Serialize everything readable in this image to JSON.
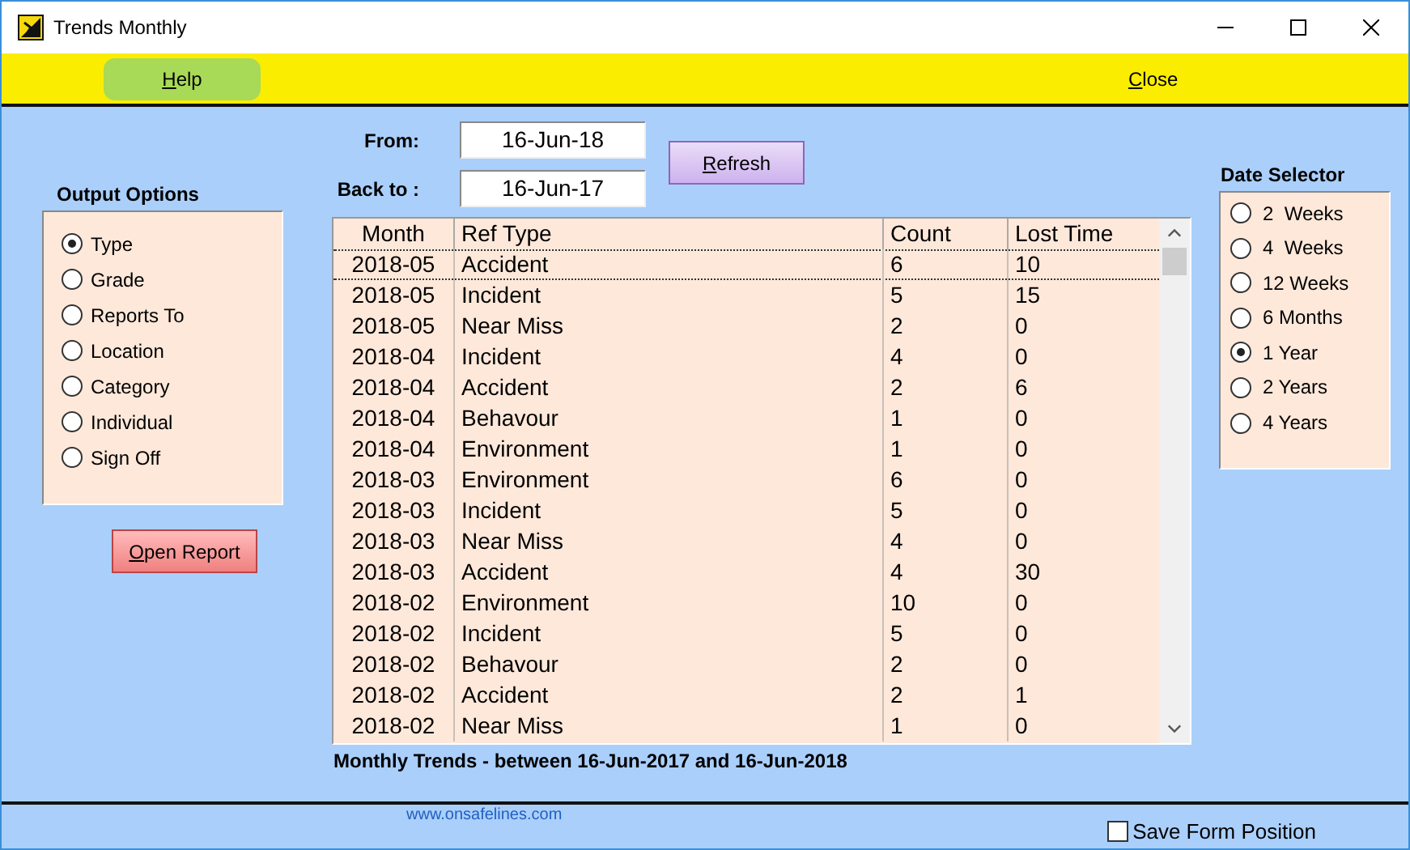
{
  "window": {
    "title": "Trends Monthly"
  },
  "toolbar": {
    "help": {
      "label": "Help",
      "underline_first": true
    },
    "close": {
      "label": "Close",
      "underline_first": true
    }
  },
  "output_options": {
    "title": "Output Options",
    "options": [
      {
        "label": "Type",
        "selected": true
      },
      {
        "label": "Grade",
        "selected": false
      },
      {
        "label": "Reports To",
        "selected": false
      },
      {
        "label": "Location",
        "selected": false
      },
      {
        "label": "Category",
        "selected": false
      },
      {
        "label": "Individual",
        "selected": false
      },
      {
        "label": "Sign Off",
        "selected": false
      }
    ],
    "open_report": {
      "label": "Open Report",
      "underline_first": true
    }
  },
  "dates": {
    "from_label": "From:",
    "from": "16-Jun-18",
    "back_label": "Back to :",
    "back": "16-Jun-17",
    "refresh": {
      "label": "Refresh",
      "underline_first": true
    }
  },
  "table": {
    "columns": [
      "Month",
      "Ref Type",
      "Count",
      "Lost Time"
    ],
    "rows": [
      {
        "cells": [
          "2018-05",
          "Accident",
          "6",
          "10"
        ],
        "selected": true
      },
      {
        "cells": [
          "2018-05",
          "Incident",
          "5",
          "15"
        ],
        "selected": false
      },
      {
        "cells": [
          "2018-05",
          "Near Miss",
          "2",
          "0"
        ],
        "selected": false
      },
      {
        "cells": [
          "2018-04",
          "Incident",
          "4",
          "0"
        ],
        "selected": false
      },
      {
        "cells": [
          "2018-04",
          "Accident",
          "2",
          "6"
        ],
        "selected": false
      },
      {
        "cells": [
          "2018-04",
          "Behavour",
          "1",
          "0"
        ],
        "selected": false
      },
      {
        "cells": [
          "2018-04",
          "Environment",
          "1",
          "0"
        ],
        "selected": false
      },
      {
        "cells": [
          "2018-03",
          "Environment",
          "6",
          "0"
        ],
        "selected": false
      },
      {
        "cells": [
          "2018-03",
          "Incident",
          "5",
          "0"
        ],
        "selected": false
      },
      {
        "cells": [
          "2018-03",
          "Near Miss",
          "4",
          "0"
        ],
        "selected": false
      },
      {
        "cells": [
          "2018-03",
          "Accident",
          "4",
          "30"
        ],
        "selected": false
      },
      {
        "cells": [
          "2018-02",
          "Environment",
          "10",
          "0"
        ],
        "selected": false
      },
      {
        "cells": [
          "2018-02",
          "Incident",
          "5",
          "0"
        ],
        "selected": false
      },
      {
        "cells": [
          "2018-02",
          "Behavour",
          "2",
          "0"
        ],
        "selected": false
      },
      {
        "cells": [
          "2018-02",
          "Accident",
          "2",
          "1"
        ],
        "selected": false
      },
      {
        "cells": [
          "2018-02",
          "Near Miss",
          "1",
          "0"
        ],
        "selected": false
      }
    ]
  },
  "summary": "Monthly Trends - between 16-Jun-2017 and 16-Jun-2018",
  "date_selector": {
    "title": "Date Selector",
    "options": [
      {
        "label": "2  Weeks",
        "selected": false
      },
      {
        "label": "4  Weeks",
        "selected": false
      },
      {
        "label": "12 Weeks",
        "selected": false
      },
      {
        "label": "6 Months",
        "selected": false
      },
      {
        "label": "1 Year",
        "selected": true
      },
      {
        "label": "2 Years",
        "selected": false
      },
      {
        "label": "4 Years",
        "selected": false
      }
    ]
  },
  "footer": {
    "link": "www.onsafelines.com",
    "save_position": {
      "label": "Save Form Position",
      "checked": false
    }
  }
}
